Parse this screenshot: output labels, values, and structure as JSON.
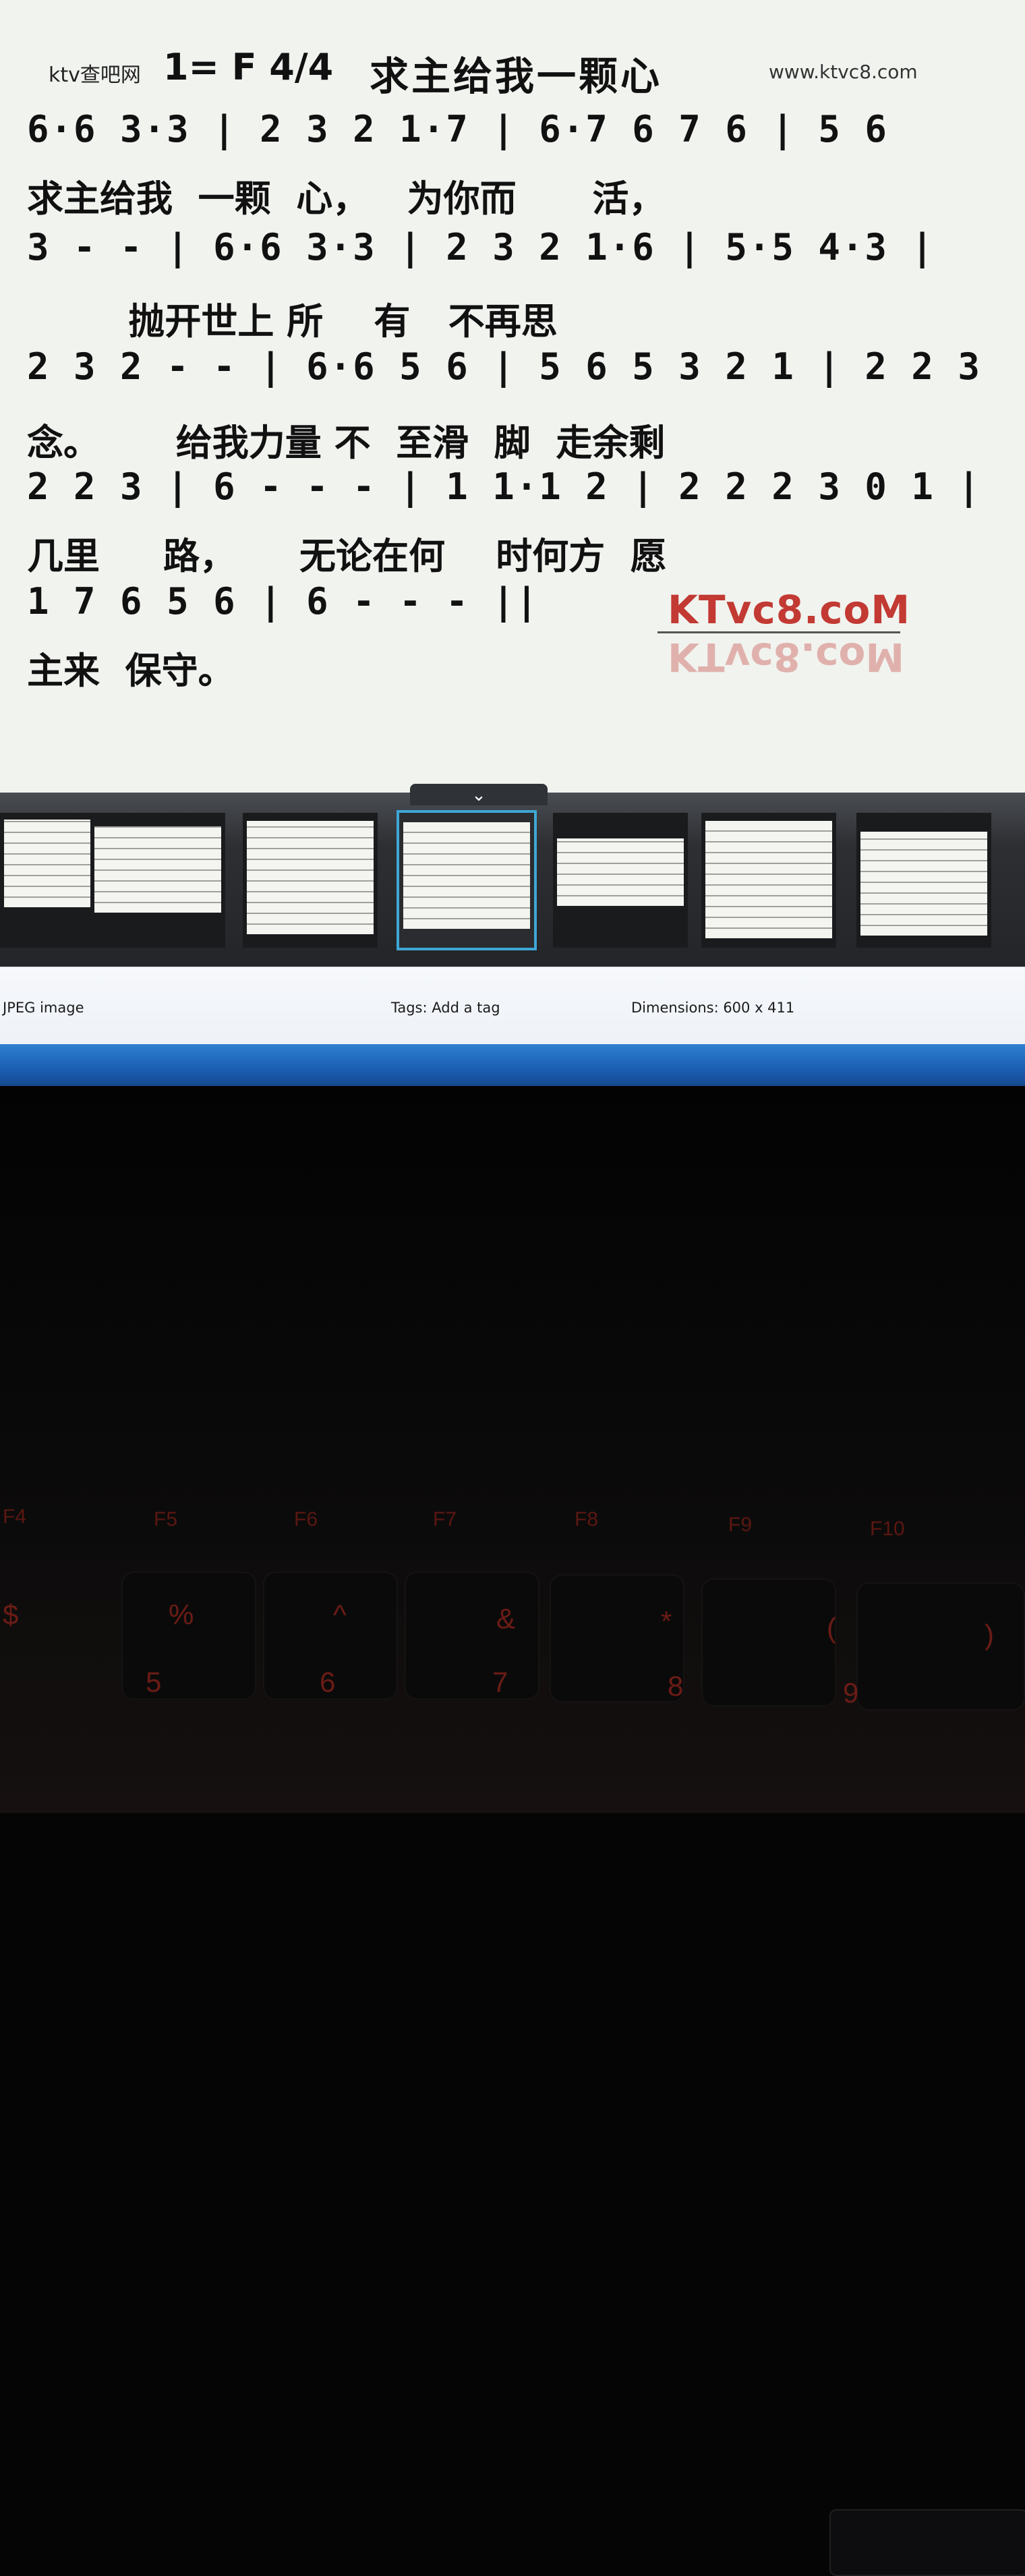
{
  "sheet": {
    "site_name": "ktv查吧网",
    "key_time": "1= F  4/4",
    "title": "求主给我一颗心",
    "site_url": "www.ktvc8.com",
    "rows": [
      {
        "notes": "6·6 3·3 | 2 3 2 1·7 | 6·7 6 7 6 | 5 6",
        "lyrics": "求主给我  一颗  心，   为你而      活，"
      },
      {
        "notes": "3 - - | 6·6 3·3 | 2 3 2 1·6 | 5·5 4·3 |",
        "lyrics": "        抛开世上 所    有   不再思"
      },
      {
        "notes": "2 3 2 - - | 6·6 5 6 | 5 6 5 3 2 1 | 2 2 3",
        "lyrics": "念。      给我力量 不  至滑  脚  走余剩"
      },
      {
        "notes": "2 2 3 | 6 - - - | 1 1·1 2 | 2 2 2 3 0 1 |",
        "lyrics": "几里     路，     无论在何    时何方  愿"
      },
      {
        "notes": "1 7 6 5 6 | 6 - - - ||",
        "lyrics": "主来  保守。"
      }
    ],
    "watermark": "KTvc8.coM"
  },
  "filmstrip": {
    "collapse_icon": "chevron-down-icon",
    "thumbnails": [
      {
        "label": "thumbnail-1"
      },
      {
        "label": "thumbnail-2"
      },
      {
        "label": "thumbnail-3"
      },
      {
        "label": "thumbnail-4",
        "active": true
      },
      {
        "label": "thumbnail-5"
      },
      {
        "label": "thumbnail-6"
      },
      {
        "label": "thumbnail-7"
      }
    ]
  },
  "statusbar": {
    "file_type": "JPEG image",
    "tags": "Tags: Add a tag",
    "dimensions": "Dimensions: 600 x 411"
  },
  "keyboard": {
    "fkeys": [
      "F4",
      "F5",
      "F6",
      "F7",
      "F8",
      "F9",
      "F10"
    ],
    "symbols": [
      "$",
      "%",
      "^",
      "&",
      "*",
      "(",
      ")"
    ],
    "digits": [
      "5",
      "6",
      "7",
      "8",
      "9"
    ]
  },
  "colors": {
    "accent": "#3fa7d6",
    "watermark": "#c23a33",
    "taskbar": "#1b5fb3"
  }
}
